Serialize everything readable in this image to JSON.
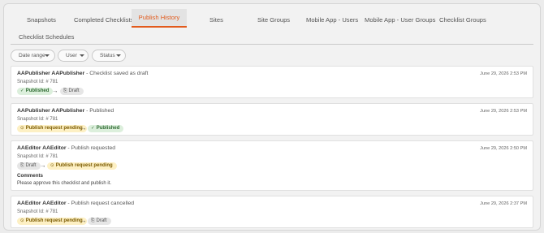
{
  "tabs": [
    {
      "label": "Snapshots"
    },
    {
      "label": "Completed Checklists"
    },
    {
      "label": "Publish History",
      "active": true
    },
    {
      "label": "Sites"
    },
    {
      "label": "Site Groups"
    },
    {
      "label": "Mobile App - Users"
    },
    {
      "label": "Mobile App - User Groups"
    },
    {
      "label": "Checklist Groups"
    },
    {
      "label": "Checklist Schedules"
    }
  ],
  "filters": [
    {
      "label": "Date range"
    },
    {
      "label": "User"
    },
    {
      "label": "Status"
    }
  ],
  "entries": [
    {
      "user": "AAPublisher AAPublisher",
      "action": " - Checklist saved as draft",
      "snapshot": "Snapshot Id: # 781",
      "date": "June 29, 2026 2:53 PM",
      "from": {
        "label": "Published",
        "status": "published"
      },
      "to": {
        "label": "Draft",
        "status": "draft"
      }
    },
    {
      "user": "AAPublisher AAPublisher",
      "action": " - Published",
      "snapshot": "Snapshot Id: # 781",
      "date": "June 29, 2026 2:53 PM",
      "from": {
        "label": "Publish request pending",
        "status": "pending"
      },
      "to": {
        "label": "Published",
        "status": "published"
      }
    },
    {
      "user": "AAEditor AAEditor",
      "action": " - Publish requested",
      "snapshot": "Snapshot Id: # 781",
      "date": "June 29, 2026 2:50 PM",
      "from": {
        "label": "Draft",
        "status": "draft"
      },
      "to": {
        "label": "Publish request pending",
        "status": "pending"
      },
      "comments_label": "Comments",
      "comment": "Please approve this checklist and publish it."
    },
    {
      "user": "AAEditor AAEditor",
      "action": " - Publish request cancelled",
      "snapshot": "Snapshot Id: # 781",
      "date": "June 29, 2026 2:37 PM",
      "from": {
        "label": "Publish request pending",
        "status": "pending"
      },
      "to": {
        "label": "Draft",
        "status": "draft"
      }
    }
  ],
  "arrow_glyph": "→",
  "icons": {
    "published": "✓",
    "pending": "⊙",
    "draft": "⎘"
  },
  "colors": {
    "accent": "#e25a1c",
    "published_bg": "#dcefdc",
    "pending_bg": "#fdf0c4",
    "draft_bg": "#e6e6e6"
  }
}
